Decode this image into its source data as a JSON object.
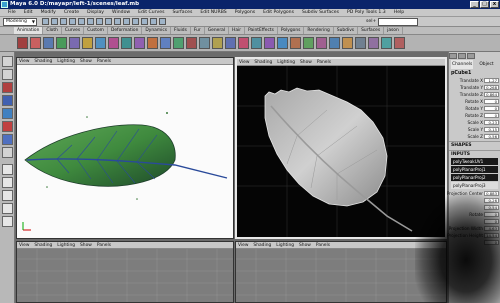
{
  "window": {
    "title": "Maya 6.0 D:/mayapr/left-1/scenes/leaf.mb",
    "buttons": [
      "_",
      "□",
      "x"
    ]
  },
  "menubar": [
    "File",
    "Edit",
    "Modify",
    "Create",
    "Display",
    "Window",
    "Edit Curves",
    "Surfaces",
    "Edit NURBS",
    "Polygons",
    "Edit Polygons",
    "Subdiv Surfaces",
    "PD Poly Tools 1.3",
    "Help"
  ],
  "statusline": {
    "mode": "Modeling",
    "sel_label": "sel+"
  },
  "shelf_tabs": [
    {
      "label": "Animation",
      "active": true
    },
    {
      "label": "Cloth"
    },
    {
      "label": "Curves"
    },
    {
      "label": "Custom"
    },
    {
      "label": "Deformation"
    },
    {
      "label": "Dynamics"
    },
    {
      "label": "Fluids"
    },
    {
      "label": "Fur"
    },
    {
      "label": "General"
    },
    {
      "label": "Hair"
    },
    {
      "label": "PaintEffects"
    },
    {
      "label": "Polygons"
    },
    {
      "label": "Rendering"
    },
    {
      "label": "Subdivs"
    },
    {
      "label": "Surfaces"
    },
    {
      "label": "jason"
    }
  ],
  "viewport_menu": [
    "View",
    "Shading",
    "Lighting",
    "Show",
    "Panels"
  ],
  "channel_box": {
    "tabs": [
      "Channels",
      "Object"
    ],
    "object_name": "pCube1",
    "attributes": [
      {
        "label": "Translate X",
        "value": "1.27"
      },
      {
        "label": "Translate Y",
        "value": "0.268"
      },
      {
        "label": "Translate Z",
        "value": "0.864"
      },
      {
        "label": "Rotate X",
        "value": "0"
      },
      {
        "label": "Rotate Y",
        "value": "0"
      },
      {
        "label": "Rotate Z",
        "value": "0"
      },
      {
        "label": "Scale X",
        "value": "0.23"
      },
      {
        "label": "Scale Y",
        "value": "0.15"
      },
      {
        "label": "Scale Z",
        "value": "0.56"
      }
    ],
    "shapes_header": "SHAPES",
    "inputs_header": "INPUTS",
    "inputs": [
      "polyTweakUV1",
      "polyPlanarProj1",
      "polyPlanarProj2",
      "polyPlanarProj3"
    ],
    "extra_rows": [
      {
        "label": "Projection Center",
        "value": "0.883"
      },
      {
        "label": "",
        "value": "0.26"
      },
      {
        "label": "",
        "value": "0.54"
      },
      {
        "label": "Rotate",
        "value": "0"
      },
      {
        "label": "",
        "value": "0"
      },
      {
        "label": "Projection Width",
        "value": "4.63"
      },
      {
        "label": "Projection Height",
        "value": "14.54"
      },
      {
        "label": "",
        "value": "0"
      }
    ]
  },
  "colors": {
    "leaf_green": "#3f8a3e",
    "leaf_dark": "#1e4a2a",
    "vein_blue": "#2a4a9a",
    "viewport_white": "#fbfbfb",
    "viewport_black": "#050505",
    "ui_gray": "#c8c8c8",
    "title_blue": "#0a246a"
  }
}
